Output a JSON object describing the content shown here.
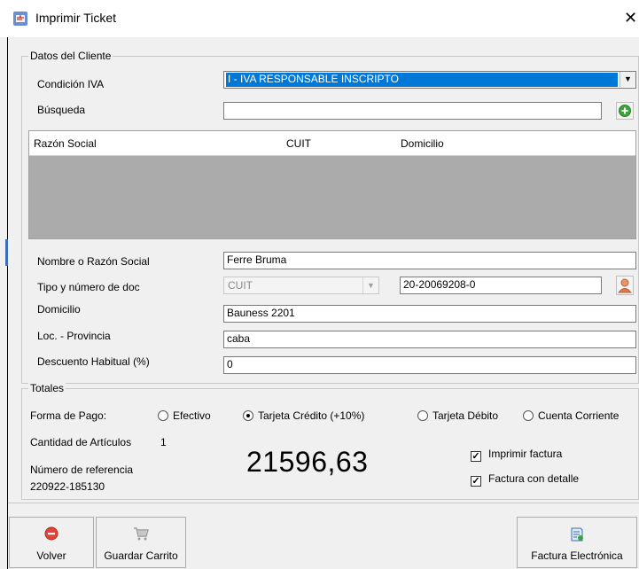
{
  "window": {
    "title": "Imprimir Ticket",
    "close_glyph": "✕"
  },
  "cliente": {
    "group_title": "Datos del Cliente",
    "condicion_iva_label": "Condición IVA",
    "condicion_iva_value": "I - IVA RESPONSABLE INSCRIPTO",
    "busqueda_label": "Búsqueda",
    "busqueda_value": "",
    "grid_columns": [
      "Razón Social",
      "CUIT",
      "Domicilio"
    ],
    "nombre_label": "Nombre o Razón Social",
    "nombre_value": "Ferre Bruma",
    "tipo_doc_label": "Tipo y número de doc",
    "tipo_doc_value": "CUIT",
    "numero_doc_value": "20-20069208-0",
    "domicilio_label": "Domicilio",
    "domicilio_value": "Bauness 2201",
    "localidad_label": "Loc. -  Provincia",
    "localidad_value": "caba",
    "descuento_label": "Descuento Habitual (%)",
    "descuento_value": "0"
  },
  "totales": {
    "group_title": "Totales",
    "forma_pago_label": "Forma de Pago:",
    "pagos": [
      {
        "label": "Efectivo",
        "selected": false
      },
      {
        "label": "Tarjeta Crédito (+10%)",
        "selected": true
      },
      {
        "label": "Tarjeta Débito",
        "selected": false
      },
      {
        "label": "Cuenta Corriente",
        "selected": false
      }
    ],
    "cantidad_label": "Cantidad de Artículos",
    "cantidad_value": "1",
    "referencia_label": "Número de referencia",
    "referencia_value": "220922-185130",
    "total_value": "21596,63",
    "imprimir_factura_label": "Imprimir factura",
    "imprimir_factura_checked": true,
    "factura_detalle_label": "Factura con detalle",
    "factura_detalle_checked": true
  },
  "buttons": {
    "volver": "Volver",
    "guardar_carrito": "Guardar Carrito",
    "factura_electronica": "Factura Electrónica"
  },
  "icons": {
    "title": "printer-ticket-icon",
    "add": "add-green-icon",
    "person": "person-icon",
    "stop": "stop-red-icon",
    "cart": "cart-icon",
    "invoice": "invoice-icon"
  },
  "colors": {
    "selection": "#0078d7",
    "add_green": "#3aa63a",
    "stop_red": "#e0443a",
    "person_orange": "#e07a4a"
  }
}
